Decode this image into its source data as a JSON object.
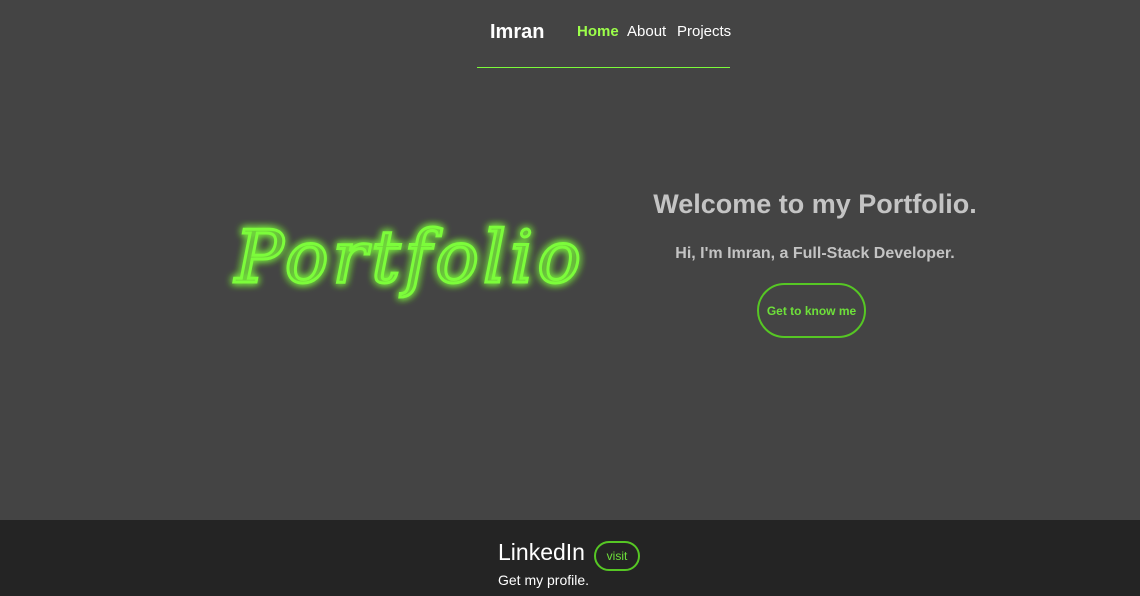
{
  "nav": {
    "brand": "Imran",
    "links": [
      {
        "label": "Home",
        "active": true
      },
      {
        "label": "About",
        "active": false
      },
      {
        "label": "Projects",
        "active": false
      }
    ]
  },
  "hero": {
    "logo_text": "Portfolio",
    "title": "Welcome to my Portfolio.",
    "subtitle": "Hi, I'm Imran, a Full-Stack Developer.",
    "cta_label": "Get to know me"
  },
  "footer": {
    "title": "LinkedIn",
    "button_label": "visit",
    "description": "Get my profile."
  },
  "colors": {
    "background": "#444444",
    "footer_background": "#242424",
    "accent": "#7cfc3a",
    "text_muted": "#c4c4c4"
  }
}
